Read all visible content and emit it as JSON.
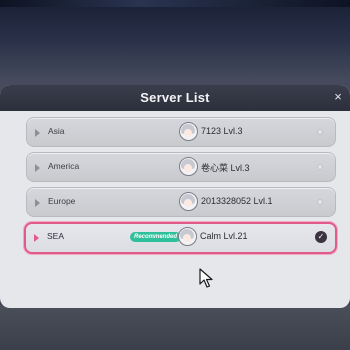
{
  "dialog": {
    "title": "Server List",
    "close_label": "×"
  },
  "servers": [
    {
      "region": "Asia",
      "player": "7123  Lvl.3",
      "recommended": false,
      "selected": false
    },
    {
      "region": "America",
      "player": "卷心菜  Lvl.3",
      "recommended": false,
      "selected": false
    },
    {
      "region": "Europe",
      "player": "2013328052  Lvl.1",
      "recommended": false,
      "selected": false
    },
    {
      "region": "SEA",
      "player": "Calm  Lvl.21",
      "recommended": true,
      "recommended_label": "Recommended",
      "selected": true
    }
  ],
  "colors": {
    "selected_border": "#e05a8a",
    "recommended_badge": "#2fbf9a",
    "header_bg": "#2c303c",
    "panel_bg": "#e6e7eb"
  },
  "icons": {
    "close": "close-icon",
    "row_arrow": "play-arrow-icon",
    "avatar": "character-avatar-icon",
    "selected_mark": "check-circle-icon",
    "cursor": "mouse-pointer-icon"
  }
}
